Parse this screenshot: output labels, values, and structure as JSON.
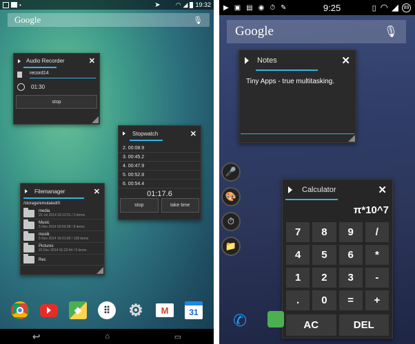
{
  "left": {
    "status": {
      "time": "19:32"
    },
    "search": {
      "brand": "Google"
    },
    "audio_recorder": {
      "title": "Audio Recorder",
      "filename": "record14",
      "elapsed": "01:30",
      "stop_label": "stop"
    },
    "stopwatch": {
      "title": "Stopwatch",
      "laps": [
        "2.  00:08.9",
        "3.  00:45.2",
        "4.  00:47.9",
        "5.  00:52.8",
        "6.  00:54.4"
      ],
      "current": "01:17.6",
      "stop_label": "stop",
      "take_time_label": "take time"
    },
    "filemanager": {
      "title": "Filemanager",
      "path": "/storage/emulated/0",
      "items": [
        {
          "name": "media",
          "meta": "25 Jul 2014 16:12:51 / 3 items"
        },
        {
          "name": "Music",
          "meta": "5 Nov 2014 00:50:28 / 8 items"
        },
        {
          "name": "musik",
          "meta": "5 Nov 2014 16:01:00 / 128 items"
        },
        {
          "name": "Pictures",
          "meta": "23 Dec 2014 01:22:44 / 5 items"
        },
        {
          "name": "Rec",
          "meta": ""
        }
      ]
    },
    "dock": {
      "calendar_day": "31"
    }
  },
  "right": {
    "status": {
      "time": "9:25",
      "battery": "89"
    },
    "search": {
      "brand": "Google"
    },
    "notes": {
      "title": "Notes",
      "text": "Tiny Apps - true multitasking."
    },
    "calculator": {
      "title": "Calculator",
      "display": "π*10^7",
      "keys": [
        "7",
        "8",
        "9",
        "/",
        "4",
        "5",
        "6",
        "*",
        "1",
        "2",
        "3",
        "-",
        ".",
        "0",
        "=",
        "+"
      ],
      "ac_label": "AC",
      "del_label": "DEL"
    }
  }
}
